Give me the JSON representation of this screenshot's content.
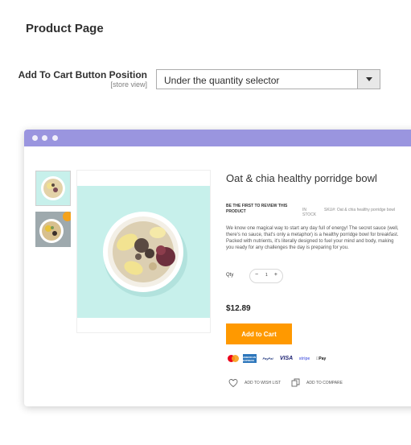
{
  "section": {
    "title": "Product Page"
  },
  "field": {
    "label": "Add To Cart Button Position",
    "scope": "[store view]",
    "selected": "Under the quantity selector"
  },
  "preview": {
    "product": {
      "name": "Oat & chia healthy porridge bowl",
      "review_link": "BE THE FIRST TO REVIEW THIS PRODUCT",
      "stock": "IN STOCK",
      "sku_label": "SKU#:",
      "sku_value": "Oat & chia healthy porridge bowl",
      "description": "We know one magical way to start any day full of energy! The secret sauce (well, there's no sauce, that's only a metaphor) is a healthy porridge bowl for breakfast. Packed with nutrients, it's literally designed to fuel your mind and body, making you ready for any challenges the day is preparing for you.",
      "qty_label": "Qty",
      "qty_value": "1",
      "price": "$12.89",
      "add_to_cart": "Add to Cart",
      "wishlist": "ADD TO WISH LIST",
      "compare": "ADD TO COMPARE"
    },
    "payment_icons": [
      "mastercard-icon",
      "amex-icon",
      "paypal-icon",
      "visa-icon",
      "stripe-icon",
      "apple-pay-icon"
    ],
    "payment_labels": {
      "amex": "AMERICAN EXPRESS",
      "paypal": "PayPal",
      "visa": "VISA",
      "stripe": "stripe",
      "apple": "Pay"
    },
    "colors": {
      "titlebar": "#9a95df",
      "accent": "#ff9900",
      "image_bg": "#c7f0eb"
    }
  }
}
